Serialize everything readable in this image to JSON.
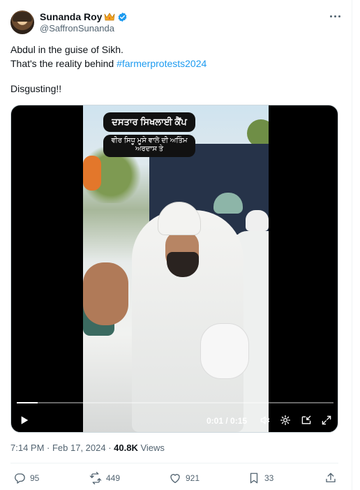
{
  "author": {
    "display_name": "Sunanda Roy",
    "handle": "@SaffronSunanda",
    "verified_color": "#1d9bf0"
  },
  "icons": {
    "avatar": "profile-avatar",
    "name_badge": "crown-icon",
    "verified": "verified-icon",
    "more": "more-options-icon"
  },
  "tweet": {
    "line1": "Abdul in the guise of Sikh.",
    "line2_prefix": "That's the reality behind ",
    "hashtag": "#farmerprotests2024",
    "line3": "Disgusting!!"
  },
  "video": {
    "overlay_caption_1": "ਦਸਤਾਰ ਸਿਖਲਾਈ ਕੈਂਪ",
    "overlay_caption_2a": "ਵੀਰ ਸਿਧੂ ਮੂਸੇ ਵਾਲੇ ਦੀ ਅਤਿੰਮ",
    "overlay_caption_2b": "ਅਰਦਾਸ ਤੇ",
    "time": "0:01 / 0:15",
    "progress": 0.067
  },
  "meta": {
    "time": "7:14 PM",
    "date": "Feb 17, 2024",
    "separator": " · ",
    "views_count": "40.8K",
    "views_label": " Views"
  },
  "actions": {
    "replies": "95",
    "reposts": "449",
    "likes": "921",
    "bookmarks": "33"
  },
  "colors": {
    "accent": "#1d9bf0",
    "text": "#0f1419",
    "muted": "#536471",
    "crown": "#f4a623"
  }
}
